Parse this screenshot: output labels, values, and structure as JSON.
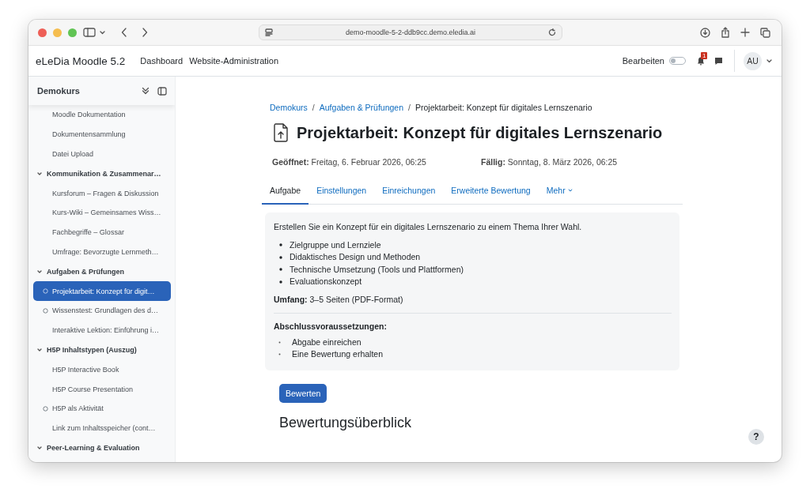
{
  "browser": {
    "url": "demo-moodle-5-2-ddb9cc.demo.eledia.ai"
  },
  "navbar": {
    "brand": "eLeDia Moodle 5.2",
    "links": [
      "Dashboard",
      "Website-Administration"
    ],
    "edit_mode": {
      "label": "Bearbeiten",
      "on": false
    },
    "notification_count": "1",
    "avatar": "AU"
  },
  "course_index": {
    "title": "Demokurs",
    "items": [
      {
        "kind": "activity",
        "label": "Moodle Dokumentation",
        "completion": false,
        "selected": false
      },
      {
        "kind": "activity",
        "label": "Dokumentensammlung",
        "completion": false,
        "selected": false
      },
      {
        "kind": "activity",
        "label": "Datei Upload",
        "completion": false,
        "selected": false
      },
      {
        "kind": "section",
        "label": "Kommunikation & Zusammenar…",
        "expanded": true,
        "children": [
          {
            "kind": "activity",
            "label": "Kursforum – Fragen & Diskussion",
            "completion": false,
            "selected": false
          },
          {
            "kind": "activity",
            "label": "Kurs-Wiki – Gemeinsames Wiss…",
            "completion": false,
            "selected": false
          },
          {
            "kind": "activity",
            "label": "Fachbegriffe – Glossar",
            "completion": false,
            "selected": false
          },
          {
            "kind": "activity",
            "label": "Umfrage: Bevorzugte Lernmeth…",
            "completion": false,
            "selected": false
          }
        ]
      },
      {
        "kind": "section",
        "label": "Aufgaben & Prüfungen",
        "expanded": true,
        "children": [
          {
            "kind": "activity",
            "label": "Projektarbeit: Konzept für digit…",
            "completion": true,
            "selected": true
          },
          {
            "kind": "activity",
            "label": "Wissenstest: Grundlagen des d…",
            "completion": true,
            "selected": false
          },
          {
            "kind": "activity",
            "label": "Interaktive Lektion: Einführung i…",
            "completion": false,
            "selected": false
          }
        ]
      },
      {
        "kind": "section",
        "label": "H5P Inhaltstypen (Auszug)",
        "expanded": true,
        "children": [
          {
            "kind": "activity",
            "label": "H5P Interactive Book",
            "completion": false,
            "selected": false
          },
          {
            "kind": "activity",
            "label": "H5P Course Presentation",
            "completion": false,
            "selected": false
          },
          {
            "kind": "activity",
            "label": "H5P als Aktivität",
            "completion": true,
            "selected": false
          },
          {
            "kind": "activity",
            "label": "Link zum Inhaltsspeicher (cont…",
            "completion": false,
            "selected": false
          }
        ]
      },
      {
        "kind": "section",
        "label": "Peer-Learning & Evaluation",
        "expanded": true
      }
    ]
  },
  "breadcrumb": [
    {
      "label": "Demokurs",
      "kind": "link"
    },
    {
      "label": "/",
      "kind": "separator"
    },
    {
      "label": "Aufgaben & Prüfungen",
      "kind": "link"
    },
    {
      "label": "/",
      "kind": "separator"
    },
    {
      "label": "Projektarbeit: Konzept für digitales Lernszenario",
      "kind": "current"
    }
  ],
  "page_title": "Projektarbeit: Konzept für digitales Lernszenario",
  "dates": [
    {
      "label": "Geöffnet:",
      "value": "Freitag, 6. Februar 2026, 06:25"
    },
    {
      "label": "Fällig:",
      "value": "Sonntag, 8. März 2026, 06:25"
    }
  ],
  "tabs": [
    {
      "label": "Aufgabe",
      "selected": true,
      "dropdown": false
    },
    {
      "label": "Einstellungen",
      "selected": false,
      "dropdown": false
    },
    {
      "label": "Einreichungen",
      "selected": false,
      "dropdown": false
    },
    {
      "label": "Erweiterte Bewertung",
      "selected": false,
      "dropdown": false
    },
    {
      "label": "Mehr",
      "selected": false,
      "dropdown": true
    }
  ],
  "description": {
    "intro": "Erstellen Sie ein Konzept für ein digitales Lernszenario zu einem Thema Ihrer Wahl.",
    "bullets": [
      "Zielgruppe und Lernziele",
      "Didaktisches Design und Methoden",
      "Technische Umsetzung (Tools und Plattformen)",
      "Evaluationskonzept"
    ],
    "scope": "**Umfang:** 3–5 Seiten (PDF-Format)"
  },
  "completion": {
    "title": "Abschlussvoraussetzungen:",
    "items": [
      "Abgabe einreichen",
      "Eine Bewertung erhalten"
    ]
  },
  "grade_button": "Bewerten",
  "section_heading": "Bewertungsüberblick",
  "help_button": "?"
}
